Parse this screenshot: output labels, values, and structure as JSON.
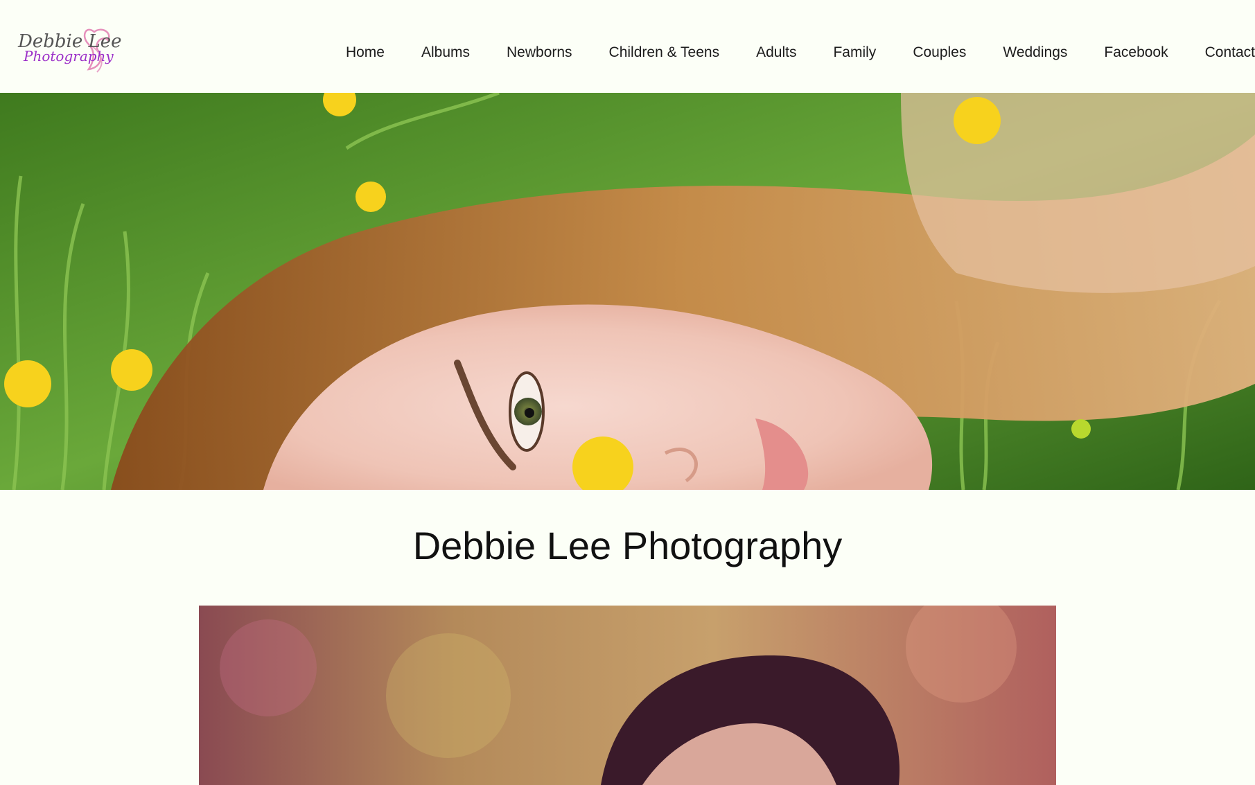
{
  "logo": {
    "line1": "Debbie Lee",
    "line2": "Photography",
    "alt": "Debbie Lee Photography logo"
  },
  "nav": {
    "items": [
      {
        "label": "Home"
      },
      {
        "label": "Albums"
      },
      {
        "label": "Newborns"
      },
      {
        "label": "Children & Teens"
      },
      {
        "label": "Adults"
      },
      {
        "label": "Family"
      },
      {
        "label": "Couples"
      },
      {
        "label": "Weddings"
      },
      {
        "label": "Facebook"
      },
      {
        "label": "Contact"
      }
    ]
  },
  "main": {
    "title": "Debbie Lee Photography"
  },
  "colors": {
    "background": "#fcfff7",
    "text": "#111111",
    "logo_pink": "#e07bb0",
    "logo_purple": "#9b2fc8"
  }
}
